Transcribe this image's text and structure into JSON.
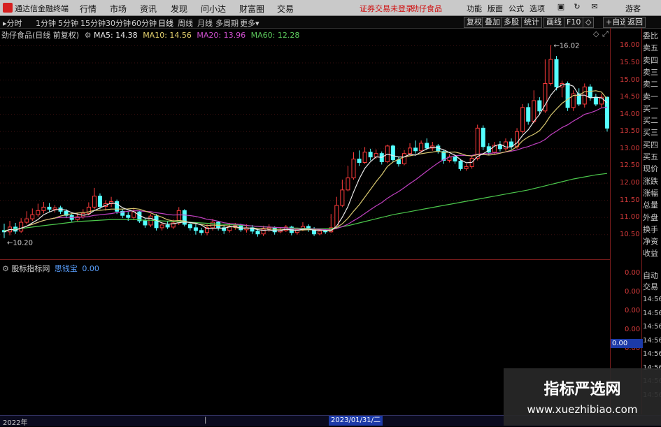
{
  "menubar": {
    "app_title": "通达信金融终端",
    "items": [
      "行情",
      "市场",
      "资讯",
      "发现",
      "问小达",
      "财富圈",
      "交易"
    ],
    "alert": "证券交易未登录",
    "stock": "劲仔食品",
    "right_items": [
      "功能",
      "版面",
      "公式",
      "选项"
    ],
    "guest": "游客"
  },
  "toolbar": {
    "periods": [
      "分时",
      "1分钟",
      "5分钟",
      "15分钟",
      "30分钟",
      "60分钟",
      "日线",
      "周线",
      "月线",
      "多周期",
      "更多"
    ],
    "right": [
      "复权",
      "叠加",
      "多股",
      "统计",
      "画线",
      "F10",
      "◇",
      "+自选",
      "返回"
    ]
  },
  "legend": {
    "title": "劲仔食品(日线 前复权)",
    "ma5": "MA5: 14.38",
    "ma10": "MA10: 14.56",
    "ma20": "MA20: 13.96",
    "ma60": "MA60: 12.28"
  },
  "indicator": {
    "title": "股标指标网",
    "name": "思钱宝",
    "value": "0.00",
    "ticks": [
      "0.00",
      "0.00",
      "0.00",
      "0.00",
      "0.00"
    ],
    "highlight": "0.00"
  },
  "right_panel": {
    "labels": [
      "委比",
      "卖五",
      "卖四",
      "卖三",
      "卖二",
      "卖一",
      "买一",
      "买二",
      "买三",
      "买四",
      "买五",
      "现价",
      "涨跌",
      "涨幅",
      "总量",
      "外盘",
      "换手",
      "净资",
      "收益"
    ],
    "indicator_labels": [
      "自动",
      "交易"
    ],
    "times": [
      "14:56",
      "14:56",
      "14:56",
      "14:56",
      "14:56",
      "14:56",
      "14:56",
      "14:56"
    ]
  },
  "bottom": {
    "year": "2022年",
    "date": "2023/01/31/二"
  },
  "watermark": {
    "line1": "指标严选网",
    "line2": "www.xuezhibiao.com"
  },
  "chart_data": {
    "type": "candlestick",
    "yticks": [
      "16.00",
      "15.50",
      "15.00",
      "14.50",
      "14.00",
      "13.50",
      "13.00",
      "12.50",
      "12.00",
      "11.50",
      "11.00",
      "10.50"
    ],
    "ylim": [
      10.25,
      16.15
    ],
    "annotations": {
      "high": "16.02",
      "low": "10.20"
    },
    "candles": [
      [
        10.62,
        10.58,
        10.82,
        10.4
      ],
      [
        10.58,
        10.72,
        10.9,
        10.48
      ],
      [
        10.72,
        10.6,
        10.84,
        10.52
      ],
      [
        10.6,
        10.86,
        10.98,
        10.55
      ],
      [
        10.86,
        10.96,
        11.18,
        10.8
      ],
      [
        10.96,
        11.08,
        11.26,
        10.9
      ],
      [
        11.08,
        11.2,
        11.4,
        11.02
      ],
      [
        11.2,
        11.3,
        11.45,
        11.12
      ],
      [
        11.3,
        11.24,
        11.42,
        11.16
      ],
      [
        11.24,
        11.28,
        11.36,
        11.14
      ],
      [
        11.28,
        11.18,
        11.34,
        11.1
      ],
      [
        11.18,
        11.06,
        11.24,
        10.98
      ],
      [
        11.06,
        10.94,
        11.12,
        10.88
      ],
      [
        10.94,
        11.02,
        11.14,
        10.88
      ],
      [
        11.02,
        11.12,
        11.24,
        10.96
      ],
      [
        11.12,
        11.3,
        11.44,
        11.06
      ],
      [
        11.3,
        11.62,
        11.86,
        11.24
      ],
      [
        11.62,
        11.32,
        11.7,
        11.24
      ],
      [
        11.32,
        11.4,
        11.5,
        11.2
      ],
      [
        11.4,
        11.46,
        11.6,
        11.3
      ],
      [
        11.46,
        11.18,
        11.52,
        11.1
      ],
      [
        11.18,
        11.06,
        11.24,
        10.98
      ],
      [
        11.06,
        11.0,
        11.16,
        10.9
      ],
      [
        11.0,
        11.16,
        11.28,
        10.92
      ],
      [
        11.16,
        10.9,
        11.2,
        10.84
      ],
      [
        10.9,
        10.78,
        10.96,
        10.7
      ],
      [
        10.78,
        11.04,
        11.1,
        10.72
      ],
      [
        11.04,
        10.7,
        11.1,
        10.62
      ],
      [
        10.7,
        10.78,
        10.86,
        10.62
      ],
      [
        10.78,
        10.72,
        10.9,
        10.66
      ],
      [
        10.72,
        10.84,
        10.94,
        10.66
      ],
      [
        10.84,
        11.2,
        11.3,
        10.78
      ],
      [
        11.2,
        10.8,
        11.24,
        10.74
      ],
      [
        10.8,
        10.7,
        10.86,
        10.62
      ],
      [
        10.7,
        10.62,
        10.8,
        10.5
      ],
      [
        10.62,
        10.56,
        10.7,
        10.48
      ],
      [
        10.56,
        10.7,
        10.8,
        10.48
      ],
      [
        10.7,
        10.86,
        10.96,
        10.62
      ],
      [
        10.86,
        10.7,
        10.9,
        10.62
      ],
      [
        10.7,
        10.62,
        10.78,
        10.52
      ],
      [
        10.62,
        10.74,
        10.84,
        10.56
      ],
      [
        10.74,
        10.76,
        10.84,
        10.64
      ],
      [
        10.76,
        10.64,
        10.82,
        10.58
      ],
      [
        10.64,
        10.7,
        10.8,
        10.56
      ],
      [
        10.7,
        10.6,
        10.78,
        10.52
      ],
      [
        10.6,
        10.52,
        10.66,
        10.44
      ],
      [
        10.52,
        10.66,
        10.76,
        10.46
      ],
      [
        10.66,
        10.7,
        10.8,
        10.58
      ],
      [
        10.7,
        10.58,
        10.74,
        10.5
      ],
      [
        10.58,
        10.62,
        10.7,
        10.54
      ],
      [
        10.62,
        10.72,
        10.78,
        10.58
      ],
      [
        10.72,
        10.56,
        10.76,
        10.48
      ],
      [
        10.56,
        10.64,
        10.7,
        10.5
      ],
      [
        10.64,
        10.74,
        10.86,
        10.6
      ],
      [
        10.74,
        10.66,
        10.8,
        10.58
      ],
      [
        10.66,
        10.52,
        10.72,
        10.46
      ],
      [
        10.52,
        10.6,
        10.66,
        10.48
      ],
      [
        10.6,
        10.58,
        10.66,
        10.52
      ],
      [
        10.58,
        10.7,
        11.1,
        10.56
      ],
      [
        10.7,
        11.35,
        11.6,
        10.66
      ],
      [
        11.35,
        11.8,
        12.1,
        11.3
      ],
      [
        11.8,
        12.15,
        12.5,
        11.76
      ],
      [
        12.15,
        12.7,
        12.9,
        12.1
      ],
      [
        12.7,
        12.6,
        12.95,
        12.5
      ],
      [
        12.6,
        12.9,
        13.05,
        12.56
      ],
      [
        12.9,
        12.76,
        13.0,
        12.66
      ],
      [
        12.76,
        12.86,
        12.98,
        12.7
      ],
      [
        12.86,
        12.62,
        12.92,
        12.54
      ],
      [
        12.62,
        13.08,
        13.12,
        12.58
      ],
      [
        13.08,
        12.68,
        13.12,
        12.62
      ],
      [
        12.68,
        12.56,
        12.76,
        12.48
      ],
      [
        12.56,
        12.86,
        12.96,
        12.52
      ],
      [
        12.86,
        13.02,
        13.16,
        12.8
      ],
      [
        13.02,
        12.94,
        13.24,
        12.86
      ],
      [
        12.94,
        13.16,
        13.24,
        12.88
      ],
      [
        13.16,
        13.02,
        13.3,
        12.96
      ],
      [
        13.02,
        13.08,
        13.2,
        12.94
      ],
      [
        13.08,
        12.92,
        13.14,
        12.86
      ],
      [
        12.92,
        12.66,
        12.98,
        12.56
      ],
      [
        12.66,
        12.76,
        12.84,
        12.6
      ],
      [
        12.76,
        12.64,
        12.82,
        12.56
      ],
      [
        12.64,
        12.42,
        12.7,
        12.36
      ],
      [
        12.42,
        12.48,
        12.56,
        12.36
      ],
      [
        12.48,
        12.72,
        12.8,
        12.42
      ],
      [
        12.72,
        13.6,
        13.7,
        12.66
      ],
      [
        13.6,
        13.06,
        13.68,
        12.96
      ],
      [
        13.06,
        12.9,
        13.16,
        12.82
      ],
      [
        12.9,
        13.1,
        13.2,
        12.84
      ],
      [
        13.1,
        13.0,
        13.22,
        12.92
      ],
      [
        13.0,
        13.2,
        13.3,
        12.94
      ],
      [
        13.2,
        13.06,
        13.3,
        12.98
      ],
      [
        13.06,
        13.5,
        13.6,
        13.0
      ],
      [
        13.5,
        14.2,
        14.3,
        13.44
      ],
      [
        14.2,
        13.8,
        14.32,
        13.7
      ],
      [
        13.8,
        14.4,
        14.7,
        13.74
      ],
      [
        14.4,
        14.1,
        14.5,
        13.98
      ],
      [
        14.1,
        14.9,
        15.6,
        14.04
      ],
      [
        14.9,
        15.6,
        16.02,
        14.84
      ],
      [
        15.6,
        14.8,
        15.7,
        14.7
      ],
      [
        14.8,
        14.9,
        14.98,
        14.5
      ],
      [
        14.9,
        14.2,
        14.96,
        14.1
      ],
      [
        14.2,
        14.6,
        14.7,
        14.1
      ],
      [
        14.6,
        14.3,
        14.76,
        14.24
      ],
      [
        14.3,
        14.8,
        14.9,
        14.2
      ],
      [
        14.8,
        14.5,
        14.88,
        14.4
      ],
      [
        14.5,
        14.3,
        14.6,
        14.24
      ],
      [
        14.3,
        14.5,
        14.6,
        14.2
      ],
      [
        14.5,
        13.6,
        14.52,
        13.5
      ]
    ],
    "ma60": [
      10.62,
      10.64,
      10.66,
      10.68,
      10.7,
      10.72,
      10.74,
      10.76,
      10.78,
      10.8,
      10.82,
      10.84,
      10.86,
      10.88,
      10.89,
      10.9,
      10.91,
      10.92,
      10.93,
      10.94,
      10.94,
      10.94,
      10.94,
      10.94,
      10.93,
      10.92,
      10.92,
      10.91,
      10.9,
      10.89,
      10.88,
      10.88,
      10.87,
      10.86,
      10.85,
      10.84,
      10.83,
      10.82,
      10.81,
      10.8,
      10.79,
      10.78,
      10.77,
      10.76,
      10.75,
      10.74,
      10.73,
      10.72,
      10.71,
      10.7,
      10.7,
      10.69,
      10.69,
      10.68,
      10.68,
      10.67,
      10.67,
      10.67,
      10.68,
      10.7,
      10.73,
      10.76,
      10.8,
      10.84,
      10.88,
      10.92,
      10.96,
      11.0,
      11.04,
      11.08,
      11.11,
      11.14,
      11.17,
      11.2,
      11.23,
      11.26,
      11.29,
      11.32,
      11.35,
      11.38,
      11.41,
      11.44,
      11.47,
      11.5,
      11.53,
      11.56,
      11.59,
      11.62,
      11.65,
      11.68,
      11.71,
      11.74,
      11.77,
      11.8,
      11.84,
      11.88,
      11.92,
      11.96,
      12.0,
      12.04,
      12.08,
      12.12,
      12.15,
      12.18,
      12.21,
      12.24,
      12.26,
      12.28
    ]
  }
}
